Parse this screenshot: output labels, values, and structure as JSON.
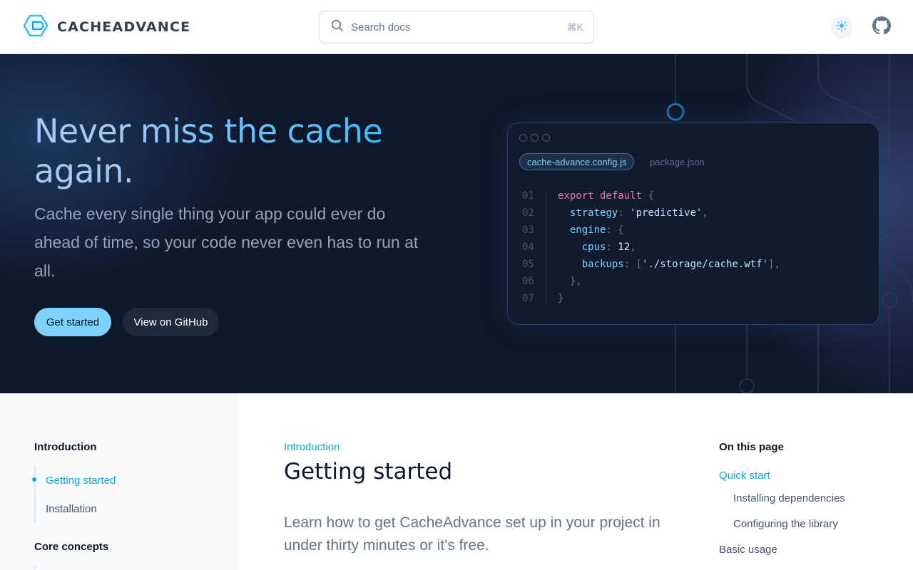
{
  "header": {
    "brand": "CACHEADVANCE",
    "search": {
      "placeholder": "Search docs",
      "shortcut": "⌘K"
    },
    "icons": [
      "logo-hexagon-icon",
      "search-icon",
      "sun-icon",
      "github-icon"
    ]
  },
  "hero": {
    "title_part1": "Never ",
    "title_accent": "miss the cache",
    "title_part2": " again.",
    "subtitle": "Cache every single thing your app could ever do ahead of time, so your code never even has to run at all.",
    "primary_button": "Get started",
    "secondary_button": "View on GitHub",
    "code": {
      "tabs": [
        {
          "label": "cache-advance.config.js",
          "active": true
        },
        {
          "label": "package.json",
          "active": false
        }
      ],
      "lines": [
        {
          "num": "01",
          "tokens": [
            {
              "t": "export default",
              "c": "kw"
            },
            {
              "t": " {",
              "c": "pun"
            }
          ]
        },
        {
          "num": "02",
          "tokens": [
            {
              "t": "  strategy",
              "c": "prop"
            },
            {
              "t": ": ",
              "c": "pun"
            },
            {
              "t": "'predictive'",
              "c": "str"
            },
            {
              "t": ",",
              "c": "pun"
            }
          ]
        },
        {
          "num": "03",
          "tokens": [
            {
              "t": "  engine",
              "c": "prop"
            },
            {
              "t": ": {",
              "c": "pun"
            }
          ]
        },
        {
          "num": "04",
          "tokens": [
            {
              "t": "    cpus",
              "c": "prop"
            },
            {
              "t": ": ",
              "c": "pun"
            },
            {
              "t": "12",
              "c": "num"
            },
            {
              "t": ",",
              "c": "pun"
            }
          ]
        },
        {
          "num": "05",
          "tokens": [
            {
              "t": "    backups",
              "c": "prop"
            },
            {
              "t": ": [",
              "c": "pun"
            },
            {
              "t": "'./storage/cache.wtf'",
              "c": "str"
            },
            {
              "t": "],",
              "c": "pun"
            }
          ]
        },
        {
          "num": "06",
          "tokens": [
            {
              "t": "  },",
              "c": "pun"
            }
          ]
        },
        {
          "num": "07",
          "tokens": [
            {
              "t": "}",
              "c": "pun"
            }
          ]
        }
      ]
    }
  },
  "sidebar": {
    "sections": [
      {
        "heading": "Introduction",
        "items": [
          {
            "label": "Getting started",
            "active": true
          },
          {
            "label": "Installation",
            "active": false
          }
        ]
      },
      {
        "heading": "Core concepts",
        "items": []
      }
    ]
  },
  "main": {
    "eyebrow": "Introduction",
    "title": "Getting started",
    "lead": "Learn how to get CacheAdvance set up in your project in under thirty minutes or it's free."
  },
  "toc": {
    "heading": "On this page",
    "items": [
      {
        "label": "Quick start",
        "level": 1,
        "active": true
      },
      {
        "label": "Installing dependencies",
        "level": 2,
        "active": false
      },
      {
        "label": "Configuring the library",
        "level": 2,
        "active": false
      },
      {
        "label": "Basic usage",
        "level": 1,
        "active": false
      }
    ]
  },
  "colors": {
    "accent": "#38bdf8",
    "hero_bg": "#0f172a",
    "primary_button": "#7dd3fc"
  }
}
